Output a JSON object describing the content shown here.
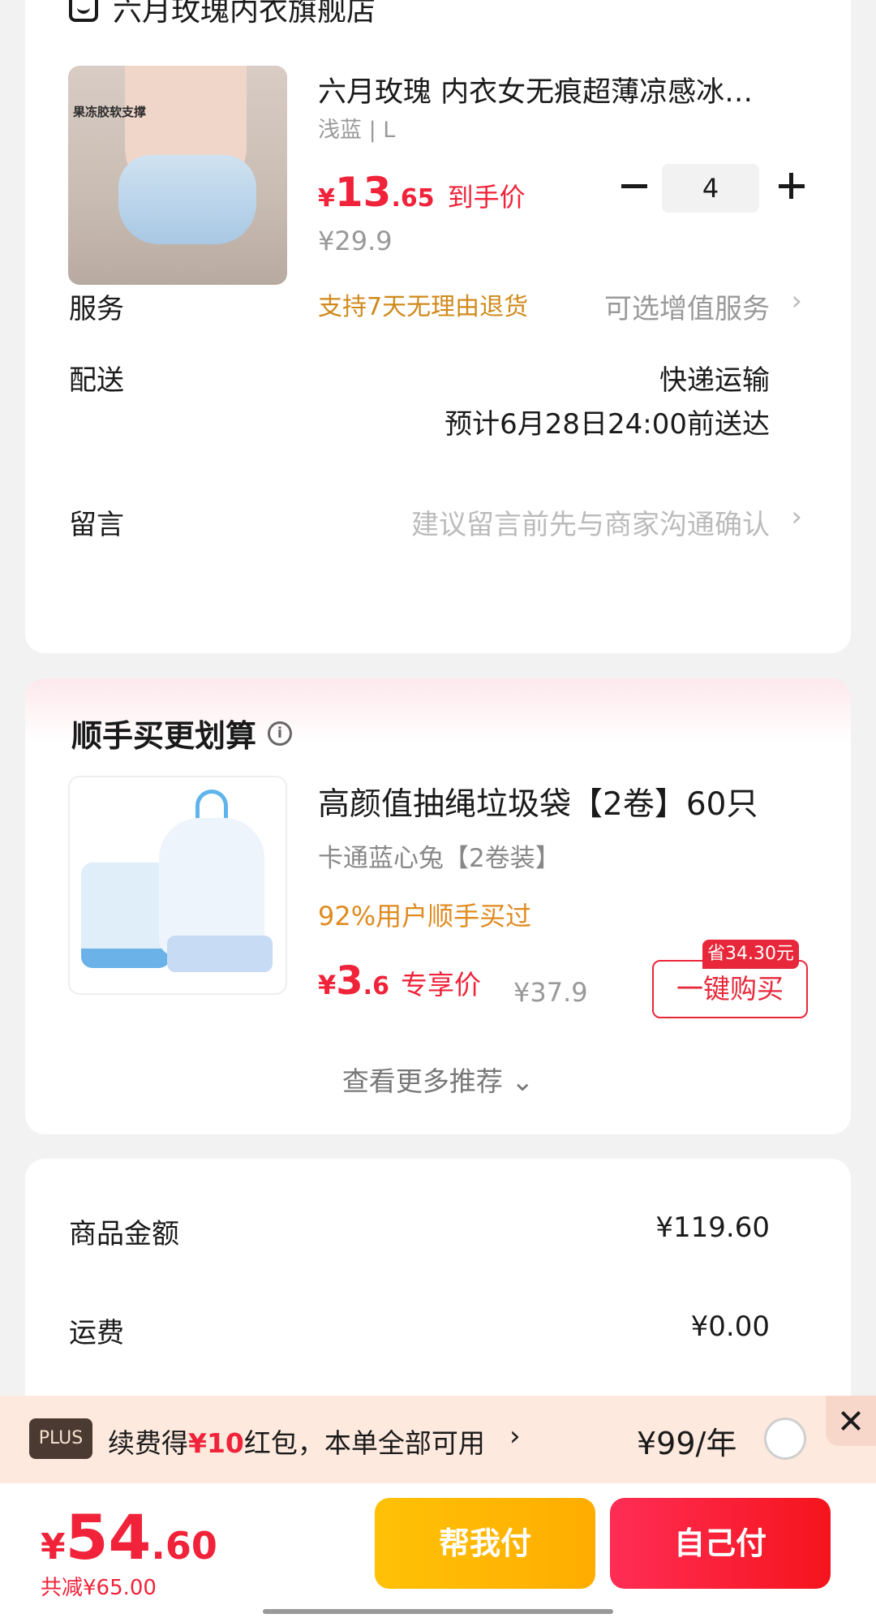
{
  "store": {
    "name": "六月玫瑰内衣旗舰店",
    "icon": "store-icon"
  },
  "product": {
    "image_tag": "果冻胶软支撑",
    "title": "六月玫瑰 内衣女无痕超薄凉感冰…",
    "spec": "浅蓝 | L",
    "price_symbol": "¥",
    "price_int": "13",
    "price_dec": ".65",
    "price_label": "到手价",
    "original_price": "¥29.9",
    "return_policy": "支持7天无理由退货",
    "quantity": "4"
  },
  "service": {
    "label": "服务",
    "value": "可选增值服务",
    "chevron": "›"
  },
  "delivery": {
    "label": "配送",
    "method": "快递运输",
    "eta": "预计6月28日24:00前送达"
  },
  "message": {
    "label": "留言",
    "placeholder": "建议留言前先与商家沟通确认",
    "chevron": "›"
  },
  "recommend": {
    "title": "顺手买更划算",
    "info_icon": "i",
    "item": {
      "title": "高颜值抽绳垃圾袋【2卷】60只",
      "spec": "卡通蓝心兔【2卷装】",
      "social": "92%用户顺手买过",
      "price_symbol": "¥",
      "price_int": "3",
      "price_dec": ".6",
      "price_label": "专享价",
      "original_price": "¥37.9",
      "save_badge": "省34.30元",
      "buy_label": "一键购买"
    },
    "more_label": "查看更多推荐 ⌄"
  },
  "summary": {
    "goods_label": "商品金额",
    "goods_value": "¥119.60",
    "shipping_label": "运费",
    "shipping_value": "¥0.00"
  },
  "plus_bar": {
    "badge": "PLUS",
    "text_prefix": "续费得",
    "text_highlight": "¥10",
    "text_suffix": "红包，本单全部可用",
    "arrow": "›",
    "price": "¥99/年"
  },
  "bottom": {
    "total_symbol": "¥",
    "total_int": "54",
    "total_dec": ".60",
    "discount": "共减¥65.00",
    "help_pay_label": "帮我付",
    "self_pay_label": "自己付"
  },
  "colors": {
    "accent_red": "#f0233a",
    "orange": "#d08a1c",
    "help_pay_yellow": "#ffc107",
    "self_pay_red": "#f5141c"
  }
}
